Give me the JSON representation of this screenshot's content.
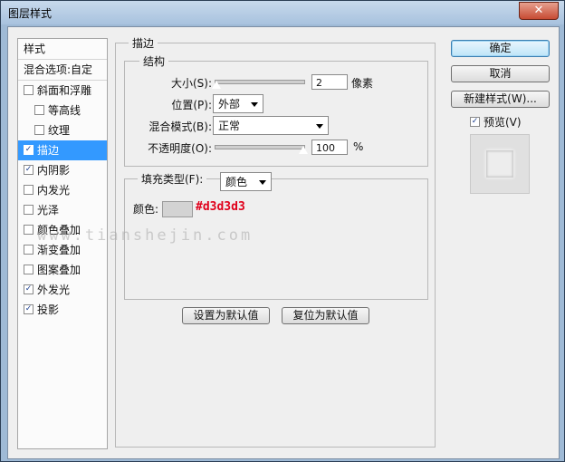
{
  "window": {
    "title": "图层样式",
    "close_label": "✕"
  },
  "left_list": {
    "header": "样式",
    "blend_options": "混合选项:自定",
    "items": [
      {
        "label": "斜面和浮雕",
        "checked": false,
        "indent": false,
        "selected": false
      },
      {
        "label": "等高线",
        "checked": false,
        "indent": true,
        "selected": false
      },
      {
        "label": "纹理",
        "checked": false,
        "indent": true,
        "selected": false
      },
      {
        "label": "描边",
        "checked": true,
        "indent": false,
        "selected": true
      },
      {
        "label": "内阴影",
        "checked": true,
        "indent": false,
        "selected": false
      },
      {
        "label": "内发光",
        "checked": false,
        "indent": false,
        "selected": false
      },
      {
        "label": "光泽",
        "checked": false,
        "indent": false,
        "selected": false
      },
      {
        "label": "颜色叠加",
        "checked": false,
        "indent": false,
        "selected": false
      },
      {
        "label": "渐变叠加",
        "checked": false,
        "indent": false,
        "selected": false
      },
      {
        "label": "图案叠加",
        "checked": false,
        "indent": false,
        "selected": false
      },
      {
        "label": "外发光",
        "checked": true,
        "indent": false,
        "selected": false
      },
      {
        "label": "投影",
        "checked": true,
        "indent": false,
        "selected": false
      }
    ]
  },
  "stroke": {
    "section_title": "描边",
    "structure_title": "结构",
    "size_label": "大小(S):",
    "size_value": "2",
    "size_unit": "像素",
    "size_level": 0.02,
    "position_label": "位置(P):",
    "position_value": "外部",
    "blend_mode_label": "混合模式(B):",
    "blend_mode_value": "正常",
    "opacity_label": "不透明度(O):",
    "opacity_value": "100",
    "opacity_unit": "%",
    "opacity_level": 1.0,
    "fill_type_label": "填充类型(F):",
    "fill_type_value": "颜色",
    "color_label": "颜色:",
    "color_hex": "#d3d3d3"
  },
  "bottom_buttons": {
    "make_default": "设置为默认值",
    "reset_default": "复位为默认值"
  },
  "right": {
    "ok": "确定",
    "cancel": "取消",
    "new_style": "新建样式(W)...",
    "preview_label": "预览(V)",
    "preview_checked": true
  },
  "watermark": "www.tianshejin.com",
  "colors": {
    "selection": "#3399ff",
    "swatch": "#d3d3d3",
    "hex_text": "#e0001b"
  }
}
